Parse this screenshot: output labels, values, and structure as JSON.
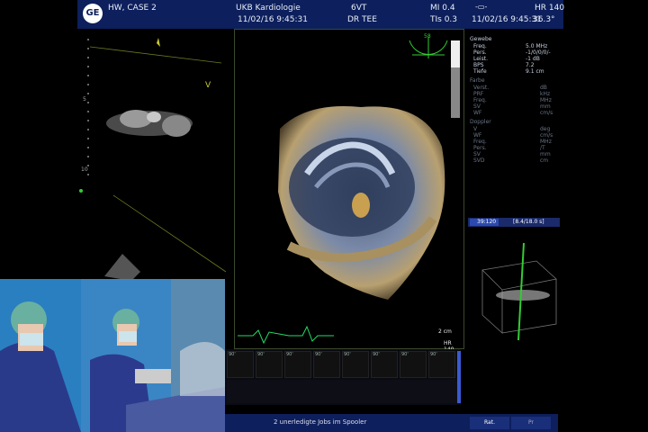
{
  "header": {
    "logo": "GE",
    "case": "HW, CASE 2",
    "institution": "UKB Kardiologie",
    "probe": "6VT",
    "mi": "MI 0.4",
    "datetime": "11/02/16 9:45:31",
    "operator": "DR TEE",
    "tis": "TIs 0.3",
    "datetime2": "11/02/16 9:45:31",
    "hr": "HR 140",
    "temp": "36.3°"
  },
  "left_pane": {
    "marker": "V",
    "depth_marks": [
      "5",
      "10"
    ]
  },
  "view3d": {
    "angle": "58",
    "scale": "2 cm",
    "hr": "HR 140"
  },
  "params": {
    "section1": "Gewebe",
    "rows1": [
      {
        "label": "Freq.",
        "value": "5.0  MHz"
      },
      {
        "label": "Pers.",
        "value": "-1/0/0/0/-"
      },
      {
        "label": "Leist.",
        "value": "-1  dB"
      },
      {
        "label": "BPS",
        "value": "7.2"
      },
      {
        "label": "Tiefe",
        "value": "9.1  cm"
      }
    ],
    "section2": "Farbe",
    "rows2": [
      {
        "label": "Verst.",
        "value": "dB"
      },
      {
        "label": "PRF",
        "value": "kHz"
      },
      {
        "label": "Freq.",
        "value": "MHz"
      },
      {
        "label": "SV",
        "value": "mm"
      },
      {
        "label": "WF",
        "value": "cm/s"
      }
    ],
    "section3": "Doppler",
    "rows3": [
      {
        "label": "V",
        "value": "deg"
      },
      {
        "label": "WF",
        "value": "cm/s"
      },
      {
        "label": "Freq.",
        "value": "MHz"
      },
      {
        "label": "Pers.",
        "value": "/T"
      },
      {
        "label": "SV",
        "value": "mm"
      },
      {
        "label": "SVD",
        "value": "cm"
      }
    ],
    "frame": "39:120",
    "range": "[8.4/18.0 s]"
  },
  "thumbnails": {
    "labels": [
      "90'",
      "90'",
      "90'",
      "90'",
      "90'",
      "90'",
      "90'",
      "90'"
    ]
  },
  "status": {
    "message": "2 unerledigte Jobs im Spooler",
    "btn1": "Rat.",
    "btn2": "Pr"
  },
  "colors": {
    "header": "#0d1f5c",
    "ecg": "#22dd66",
    "accent_green": "#33cc33",
    "video_bg": "#2a7fc0"
  }
}
